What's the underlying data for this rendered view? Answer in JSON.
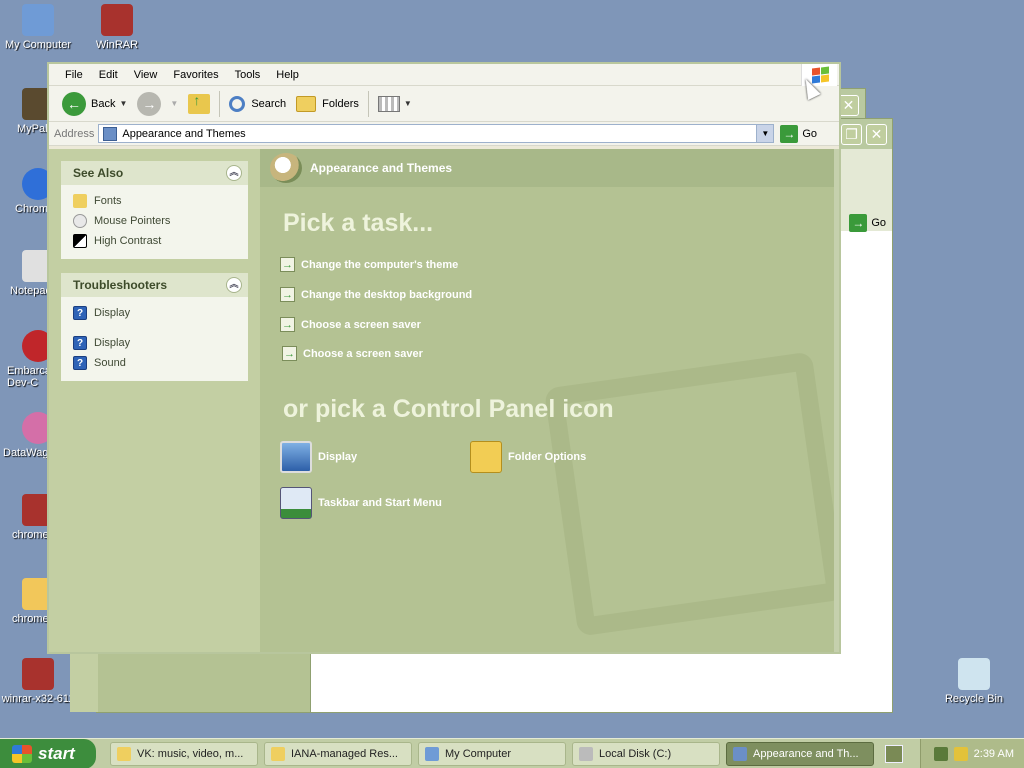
{
  "desktop": {
    "icons": [
      {
        "label": "My Computer",
        "color": "#6f9bd6"
      },
      {
        "label": "WinRAR",
        "color": "#a8322d"
      },
      {
        "label": "MyPal",
        "color": "#5a4a2f"
      },
      {
        "label": "Chrom",
        "color": "#2f6fd8"
      },
      {
        "label": "Notepac",
        "color": "#e0e0e0"
      },
      {
        "label": "Embarca Dev-C",
        "color": "#c0262a"
      },
      {
        "label": "DataWag",
        "color": "#d46fa8"
      },
      {
        "label": "chrome",
        "color": "#a8322d"
      },
      {
        "label": "chrome",
        "color": "#f2c75a"
      },
      {
        "label": "winrar-x32-611",
        "color": "#a8322d"
      },
      {
        "label": "Recycle Bin",
        "color": "#cfe4ef"
      }
    ]
  },
  "background_window": {
    "go_label": "Go",
    "close_glyph": "✕",
    "maximize_glyph": "❐"
  },
  "window": {
    "menu": [
      "File",
      "Edit",
      "View",
      "Favorites",
      "Tools",
      "Help"
    ],
    "toolbar": {
      "back": "Back",
      "search": "Search",
      "folders": "Folders"
    },
    "address": {
      "label": "Address",
      "value": "Appearance and Themes",
      "go": "Go"
    }
  },
  "taskpane": {
    "see_also": {
      "title": "See Also",
      "items": [
        "Fonts",
        "Mouse Pointers",
        "High Contrast"
      ]
    },
    "troubleshooters": {
      "title": "Troubleshooters",
      "items": [
        "Display",
        "Display",
        "Sound"
      ]
    }
  },
  "main": {
    "header": "Appearance and Themes",
    "pick_task": "Pick a task...",
    "tasks": [
      "Change the computer's theme",
      "Change the desktop background",
      "Choose a screen saver",
      "Choose a screen saver"
    ],
    "or_pick": "or pick a Control Panel icon",
    "icons": [
      "Display",
      "Folder Options",
      "Taskbar and Start Menu"
    ]
  },
  "taskbar": {
    "start": "start",
    "items": [
      {
        "label": "VK: music, video, m...",
        "active": false
      },
      {
        "label": "IANA-managed Res...",
        "active": false
      },
      {
        "label": "My Computer",
        "active": false
      },
      {
        "label": "Local Disk (C:)",
        "active": false
      },
      {
        "label": "Appearance and Th...",
        "active": true
      }
    ],
    "clock": "2:39 AM"
  },
  "colors": {
    "pane_green": "#b4c293",
    "taskpane_green": "#c3cfa3",
    "accent_green": "#3b9a3b"
  }
}
